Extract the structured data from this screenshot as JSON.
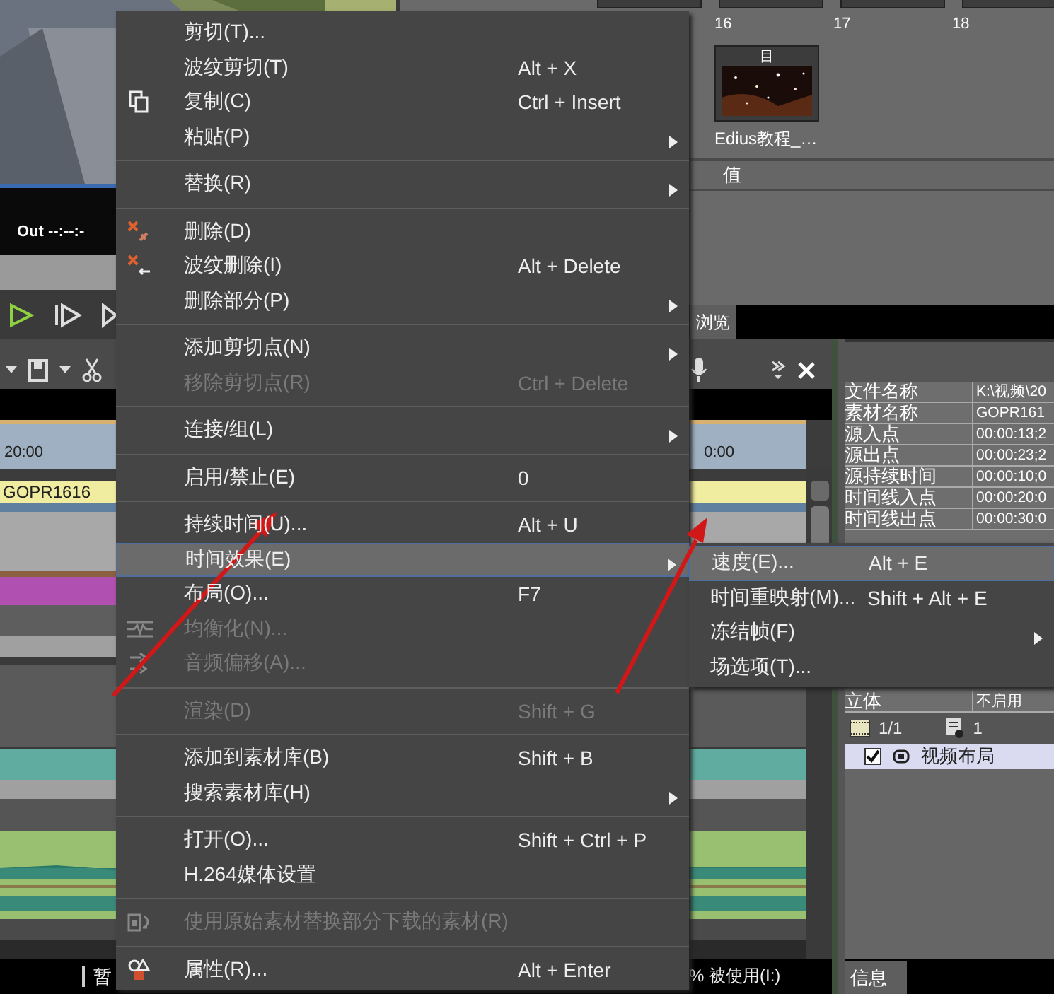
{
  "preview": {
    "out_timecode": "Out --:--:-"
  },
  "bin": {
    "top_labels": [
      "16",
      "17",
      "18"
    ],
    "clips": [
      {
        "badge": "目",
        "label": "Edius教程_…"
      }
    ],
    "column_header": "值",
    "tab": "浏览"
  },
  "timeline": {
    "ruler_left": "20:00",
    "ruler_right": "0:00",
    "clip": "GOPR1616",
    "status_left": "暂",
    "status_right": "% 被使用(I:)"
  },
  "info": {
    "rows": [
      {
        "name": "文件名称",
        "value": "K:\\视频\\20"
      },
      {
        "name": "素材名称",
        "value": "GOPR161"
      },
      {
        "name": "源入点",
        "value": "00:00:13;2"
      },
      {
        "name": "源出点",
        "value": "00:00:23;2"
      },
      {
        "name": "源持续时间",
        "value": "00:00:10;0"
      },
      {
        "name": "时间线入点",
        "value": "00:00:20:0"
      },
      {
        "name": "时间线出点",
        "value": "00:00:30:0"
      }
    ],
    "last_row": {
      "name": "立体",
      "value": "不启用"
    },
    "clip_count": "1/1",
    "layer_count": "1",
    "layouts": [
      {
        "label": "视频布局",
        "checked": true
      }
    ],
    "tab": "信息"
  },
  "context_menu": {
    "groups": [
      [
        {
          "label": "剪切(T)...",
          "submenu": false,
          "disabled": false,
          "selected": false
        },
        {
          "label": "波纹剪切(T)",
          "shortcut": "Alt + X",
          "submenu": false,
          "disabled": false,
          "selected": false
        },
        {
          "label": "复制(C)",
          "shortcut": "Ctrl + Insert",
          "submenu": false,
          "disabled": false,
          "selected": false
        },
        {
          "label": "粘贴(P)",
          "submenu": true,
          "disabled": false,
          "selected": false
        }
      ],
      [
        {
          "label": "替换(R)",
          "submenu": true,
          "disabled": false,
          "selected": false
        }
      ],
      [
        {
          "label": "删除(D)",
          "submenu": false,
          "disabled": false,
          "selected": false
        },
        {
          "label": "波纹删除(I)",
          "shortcut": "Alt + Delete",
          "submenu": false,
          "disabled": false,
          "selected": false
        },
        {
          "label": "删除部分(P)",
          "submenu": true,
          "disabled": false,
          "selected": false
        }
      ],
      [
        {
          "label": "添加剪切点(N)",
          "submenu": true,
          "disabled": false,
          "selected": false
        },
        {
          "label": "移除剪切点(R)",
          "shortcut": "Ctrl + Delete",
          "submenu": false,
          "disabled": true,
          "selected": false
        }
      ],
      [
        {
          "label": "连接/组(L)",
          "submenu": true,
          "disabled": false,
          "selected": false
        }
      ],
      [
        {
          "label": "启用/禁止(E)",
          "shortcut": "0",
          "submenu": false,
          "disabled": false,
          "selected": false
        }
      ],
      [
        {
          "label": "持续时间(U)...",
          "shortcut": "Alt + U",
          "submenu": false,
          "disabled": false,
          "selected": false
        },
        {
          "label": "时间效果(E)",
          "submenu": true,
          "disabled": false,
          "selected": true
        },
        {
          "label": "布局(O)...",
          "shortcut": "F7",
          "submenu": false,
          "disabled": false,
          "selected": false
        },
        {
          "label": "均衡化(N)...",
          "submenu": false,
          "disabled": true,
          "selected": false
        },
        {
          "label": "音频偏移(A)...",
          "submenu": false,
          "disabled": true,
          "selected": false
        }
      ],
      [
        {
          "label": "渲染(D)",
          "shortcut": "Shift + G",
          "submenu": false,
          "disabled": true,
          "selected": false
        }
      ],
      [
        {
          "label": "添加到素材库(B)",
          "shortcut": "Shift + B",
          "submenu": false,
          "disabled": false,
          "selected": false
        },
        {
          "label": "搜索素材库(H)",
          "submenu": true,
          "disabled": false,
          "selected": false
        }
      ],
      [
        {
          "label": "打开(O)...",
          "shortcut": "Shift + Ctrl + P",
          "submenu": false,
          "disabled": false,
          "selected": false
        },
        {
          "label": "H.264媒体设置",
          "submenu": false,
          "disabled": false,
          "selected": false
        }
      ],
      [
        {
          "label": "使用原始素材替换部分下载的素材(R)",
          "submenu": false,
          "disabled": true,
          "selected": false
        }
      ],
      [
        {
          "label": "属性(R)...",
          "shortcut": "Alt + Enter",
          "submenu": false,
          "disabled": false,
          "selected": false
        }
      ]
    ]
  },
  "submenu": {
    "items": [
      {
        "label": "速度(E)...",
        "shortcut": "Alt + E",
        "submenu": false,
        "selected": true
      },
      {
        "label": "时间重映射(M)...",
        "shortcut": "Shift + Alt + E",
        "submenu": false,
        "selected": false
      },
      {
        "label": "冻结帧(F)",
        "submenu": true,
        "selected": false
      },
      {
        "label": "场选项(T)...",
        "submenu": false,
        "selected": false
      }
    ]
  }
}
